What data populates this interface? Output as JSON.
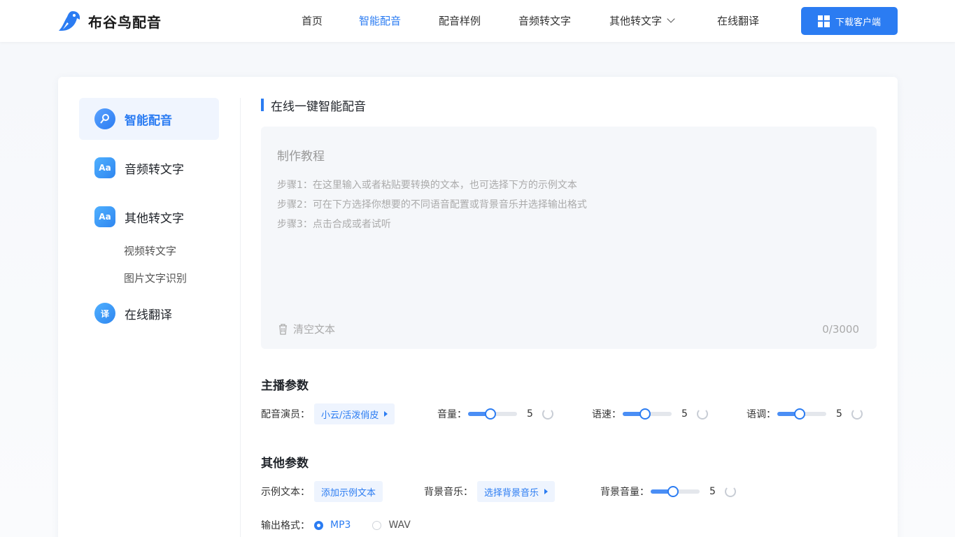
{
  "app": {
    "name": "布谷鸟配音"
  },
  "nav": {
    "items": [
      {
        "label": "首页",
        "active": false
      },
      {
        "label": "智能配音",
        "active": true
      },
      {
        "label": "配音样例",
        "active": false
      },
      {
        "label": "音频转文字",
        "active": false
      },
      {
        "label": "其他转文字",
        "active": false,
        "dropdown": true
      },
      {
        "label": "在线翻译",
        "active": false
      }
    ],
    "download_label": "下载客户端"
  },
  "sidebar": {
    "items": [
      {
        "label": "智能配音",
        "icon": "mic-icon",
        "active": true
      },
      {
        "label": "音频转文字",
        "icon": "aa-text-icon",
        "active": false
      },
      {
        "label": "其他转文字",
        "icon": "aa-wave-icon",
        "active": false
      }
    ],
    "sub_items": [
      "视频转文字",
      "图片文字识别"
    ],
    "translate": {
      "label": "在线翻译",
      "icon": "translate-icon"
    }
  },
  "editor": {
    "section_title": "在线一键智能配音",
    "tutorial_title": "制作教程",
    "steps": [
      "步骤1：在这里输入或者粘贴要转换的文本，也可选择下方的示例文本",
      "步骤2：可在下方选择你想要的不同语音配置或背景音乐并选择输出格式",
      "步骤3：点击合成或者试听"
    ],
    "clear_label": "清空文本",
    "count": "0/3000"
  },
  "anchor_params": {
    "title": "主播参数",
    "voice_label": "配音演员：",
    "voice_value": "小云/活泼俏皮",
    "volume_label": "音量：",
    "volume_value": "5",
    "volume_fraction": 0.45,
    "speed_label": "语速：",
    "speed_value": "5",
    "speed_fraction": 0.45,
    "pitch_label": "语调：",
    "pitch_value": "5",
    "pitch_fraction": 0.45
  },
  "other_params": {
    "title": "其他参数",
    "sample_label": "示例文本：",
    "sample_button": "添加示例文本",
    "bgm_label": "背景音乐：",
    "bgm_button": "选择背景音乐",
    "bgm_volume_label": "背景音量：",
    "bgm_volume_value": "5",
    "bgm_volume_fraction": 0.45,
    "format_label": "输出格式：",
    "formats": [
      {
        "label": "MP3",
        "selected": true
      },
      {
        "label": "WAV",
        "selected": false
      }
    ]
  },
  "colors": {
    "accent": "#2b7cf2",
    "text": "#333333",
    "muted": "#aaaaaa"
  }
}
